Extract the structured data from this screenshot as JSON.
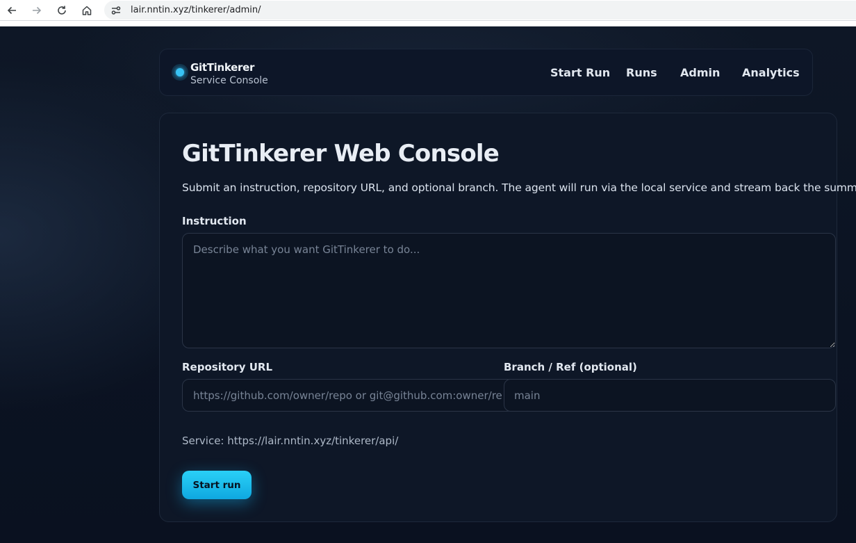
{
  "browser": {
    "url": "lair.nntin.xyz/tinkerer/admin/",
    "icons": [
      "back-arrow-icon",
      "forward-arrow-icon",
      "reload-icon",
      "home-icon",
      "site-info-icon"
    ]
  },
  "header": {
    "brand_name": "GitTinkerer",
    "brand_subtitle": "Service Console",
    "nav": [
      "Start Run",
      "Runs",
      "Admin",
      "Analytics"
    ]
  },
  "main": {
    "title": "GitTinkerer Web Console",
    "subtitle": "Submit an instruction, repository URL, and optional branch. The agent will run via the local service and stream back the summary.",
    "instruction_label": "Instruction",
    "instruction_placeholder": "Describe what you want GitTinkerer to do...",
    "repo_label": "Repository URL",
    "repo_placeholder": "https://github.com/owner/repo or git@github.com:owner/repo",
    "branch_label": "Branch / Ref (optional)",
    "branch_placeholder": "main",
    "service_text": "Service: https://lair.nntin.xyz/tinkerer/api/",
    "start_button": "Start run"
  },
  "colors": {
    "accent": "#1fbff0",
    "background": "#0b1220",
    "card": "#0e1727"
  }
}
